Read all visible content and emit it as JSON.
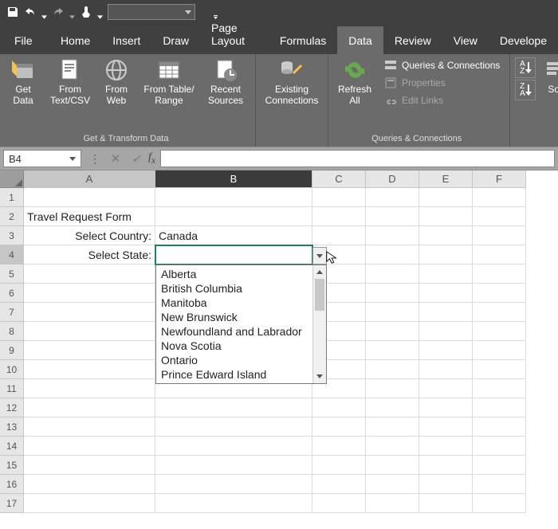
{
  "tabs": {
    "file": "File",
    "home": "Home",
    "insert": "Insert",
    "draw": "Draw",
    "pagelayout": "Page Layout",
    "formulas": "Formulas",
    "data": "Data",
    "review": "Review",
    "view": "View",
    "developer": "Develope"
  },
  "ribbon": {
    "get_data": "Get\nData",
    "from_textcsv": "From\nText/CSV",
    "from_web": "From\nWeb",
    "from_tablerange": "From Table/\nRange",
    "recent_sources": "Recent\nSources",
    "existing_connections": "Existing\nConnections",
    "refresh_all": "Refresh\nAll",
    "queries_conn": "Queries & Connections",
    "properties": "Properties",
    "edit_links": "Edit Links",
    "sort": "Sort",
    "group_get_transform": "Get & Transform Data",
    "group_queries_conn": "Queries & Connections"
  },
  "formula_bar": {
    "name_box": "B4",
    "formula": ""
  },
  "grid": {
    "cols": [
      "A",
      "B",
      "C",
      "D",
      "E",
      "F"
    ],
    "a2": "Travel Request Form",
    "a3": "Select Country:",
    "b3": "Canada",
    "a4": "Select State:",
    "b4": ""
  },
  "dropdown": {
    "items": [
      "Alberta",
      "British Columbia",
      "Manitoba",
      "New Brunswick",
      "Newfoundland and Labrador",
      "Nova Scotia",
      "Ontario",
      "Prince Edward Island"
    ]
  }
}
